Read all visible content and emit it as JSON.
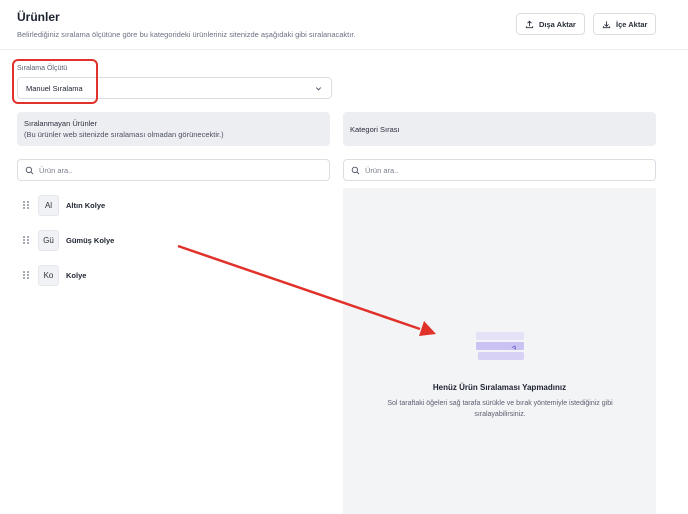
{
  "header": {
    "title": "Ürünler",
    "subtitle": "Belirlediğiniz sıralama ölçütüne göre bu kategorideki ürünleriniz sitenizde aşağıdaki gibi sıralanacaktır.",
    "export_label": "Dışa Aktar",
    "import_label": "İçe Aktar"
  },
  "sort": {
    "label": "Sıralama Ölçütü",
    "selected": "Manuel Sıralama"
  },
  "left_panel": {
    "title": "Sıralanmayan Ürünler",
    "subtitle": "(Bu ürünler web sitenizde sıralaması olmadan görünecektir.)",
    "search_placeholder": "Ürün ara.."
  },
  "right_panel": {
    "title": "Kategori Sırası",
    "search_placeholder": "Ürün ara..",
    "empty_title": "Henüz Ürün Sıralaması Yapmadınız",
    "empty_desc": "Sol taraftaki öğeleri sağ tarafa sürükle ve bırak yöntemiyle istediğiniz gibi sıralayabilirsiniz."
  },
  "products": [
    {
      "initials": "Al",
      "name": "Altın Kolye"
    },
    {
      "initials": "Gü",
      "name": "Gümüş Kolye"
    },
    {
      "initials": "Ko",
      "name": "Kolye"
    }
  ],
  "colors": {
    "annotation_red": "#e0312a",
    "illustration_purple": "#c9c2f2"
  },
  "icons": [
    "upload-icon",
    "download-icon",
    "chevron-down-icon",
    "search-icon",
    "drag-handle-icon"
  ]
}
